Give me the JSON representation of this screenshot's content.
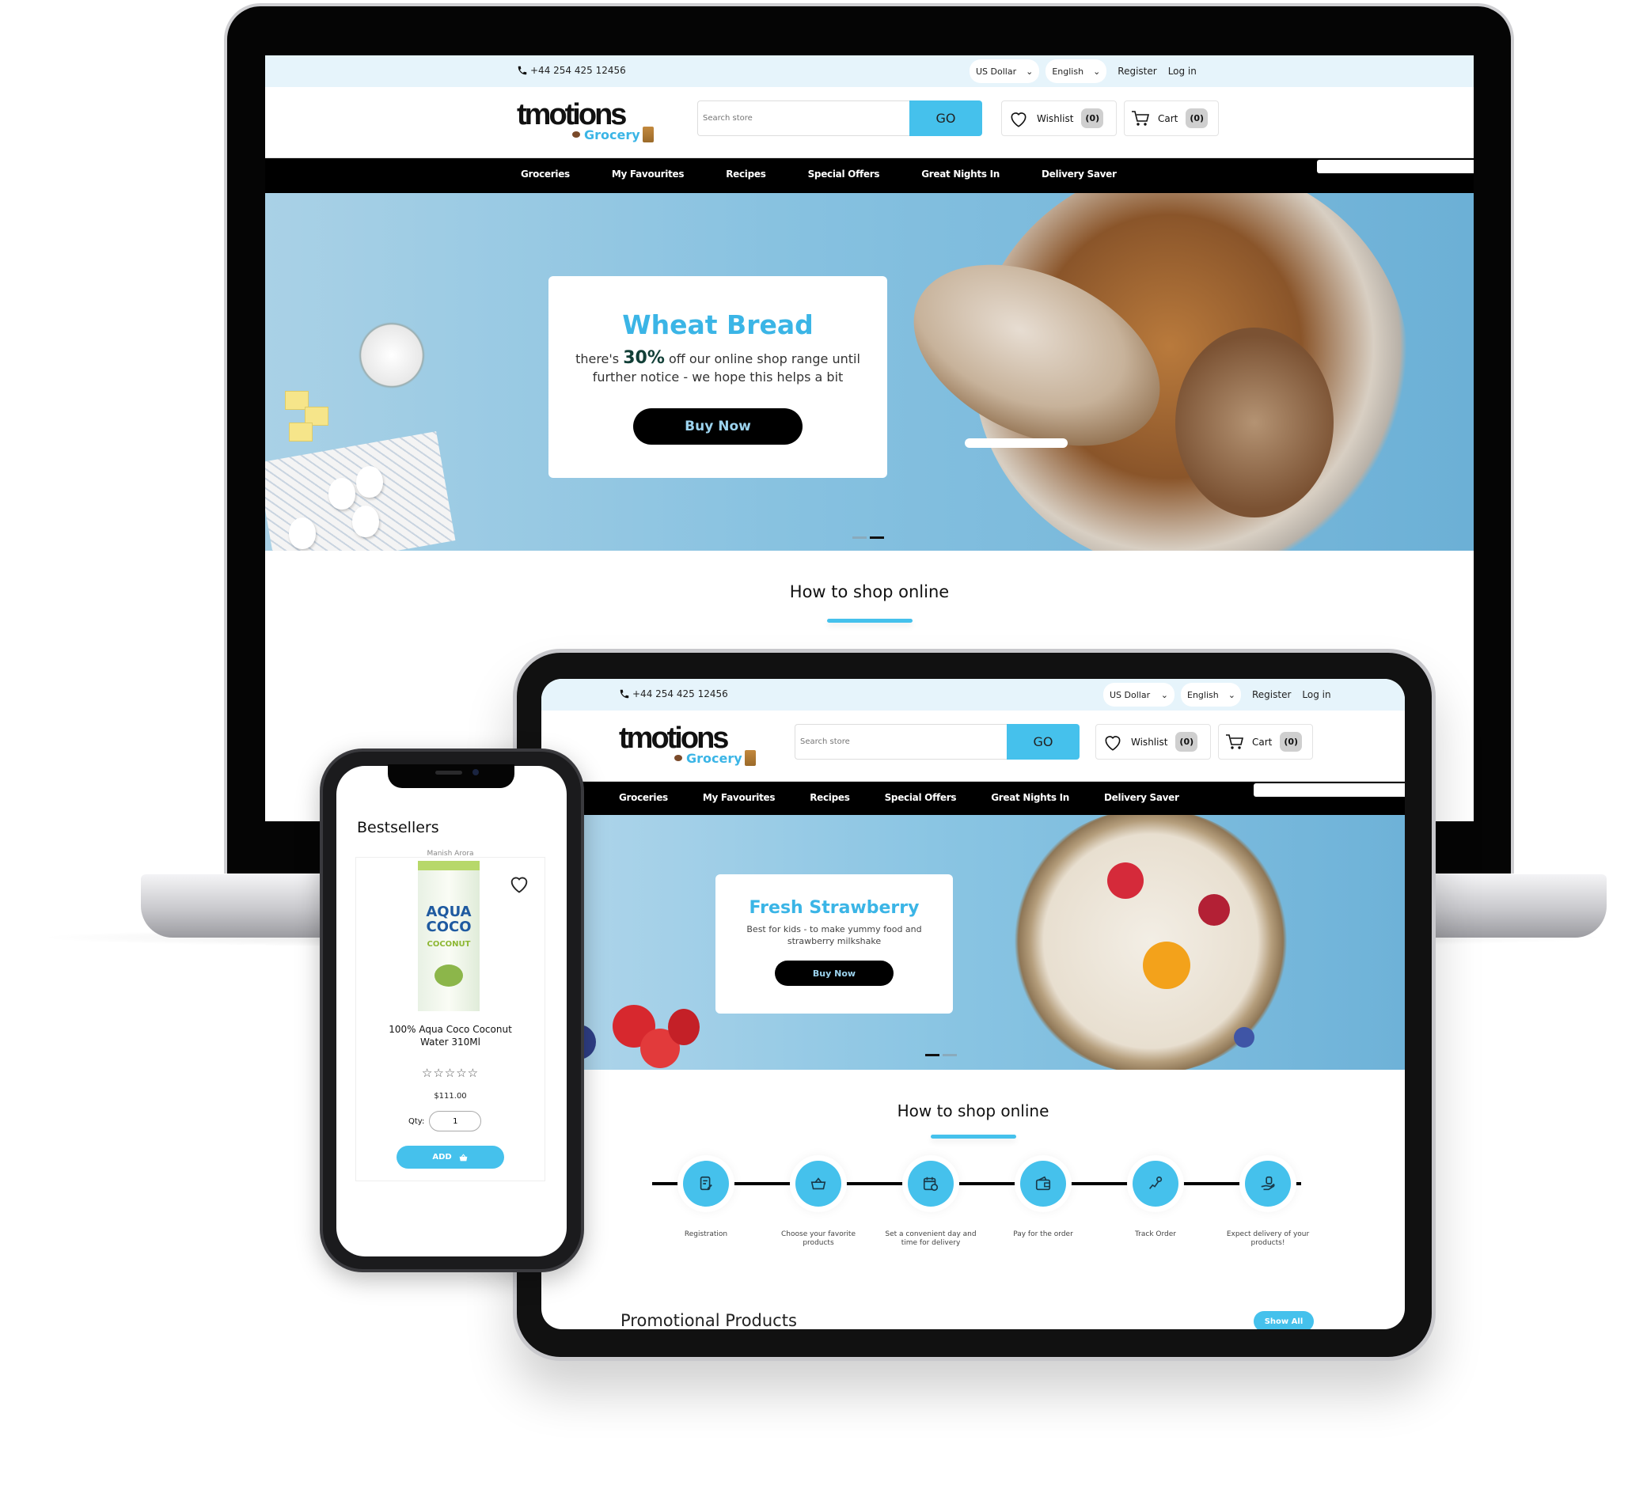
{
  "site": {
    "phone": "+44 254 425 12456",
    "currency": "US Dollar",
    "language": "English",
    "register": "Register",
    "login": "Log in",
    "logo_word": "tmotions",
    "logo_sub": "Grocery",
    "search_placeholder": "Search store",
    "search_button": "GO",
    "wishlist_label": "Wishlist",
    "wishlist_count": "(0)",
    "cart_label": "Cart",
    "cart_count": "(0)",
    "nav": [
      "Groceries",
      "My Favourites",
      "Recipes",
      "Special Offers",
      "Great Nights In",
      "Delivery Saver"
    ],
    "section_how_to": "How to shop online",
    "section_promotional": "Promotional Products",
    "show_all": "Show All",
    "accent_color": "#45c1ec"
  },
  "laptop": {
    "hero": {
      "title": "Wheat Bread",
      "line1_prefix": "there's ",
      "line1_highlight": "30%",
      "line1_suffix": " off our online shop range until",
      "line2": "further notice - we hope this helps a bit",
      "button": "Buy Now",
      "slide_active": 2,
      "slide_count": 2
    }
  },
  "tablet": {
    "hero": {
      "title": "Fresh Strawberry",
      "line1": "Best for kids - to make yummy food and",
      "line2": "strawberry milkshake",
      "button": "Buy Now",
      "slide_active": 1,
      "slide_count": 2
    },
    "steps": [
      {
        "icon": "registration-icon",
        "label": "Registration"
      },
      {
        "icon": "basket-icon",
        "label": "Choose your favorite products"
      },
      {
        "icon": "calendar-clock-icon",
        "label": "Set a convenient day and time for delivery"
      },
      {
        "icon": "wallet-icon",
        "label": "Pay for the order"
      },
      {
        "icon": "route-icon",
        "label": "Track Order"
      },
      {
        "icon": "hand-package-icon",
        "label": "Expect delivery of your products!"
      }
    ]
  },
  "phone": {
    "section_title": "Bestsellers",
    "product": {
      "vendor": "Manish Arora",
      "name_line1": "100% Aqua Coco Coconut",
      "name_line2": "Water 310Ml",
      "rating": 0,
      "rating_max": 5,
      "stars": "☆☆☆☆☆",
      "price": "$111.00",
      "qty_label": "Qty:",
      "qty_value": "1",
      "add_button": "ADD",
      "can_text_1": "AQUA",
      "can_text_2": "COCO",
      "can_text_3": "COCONUT"
    }
  }
}
